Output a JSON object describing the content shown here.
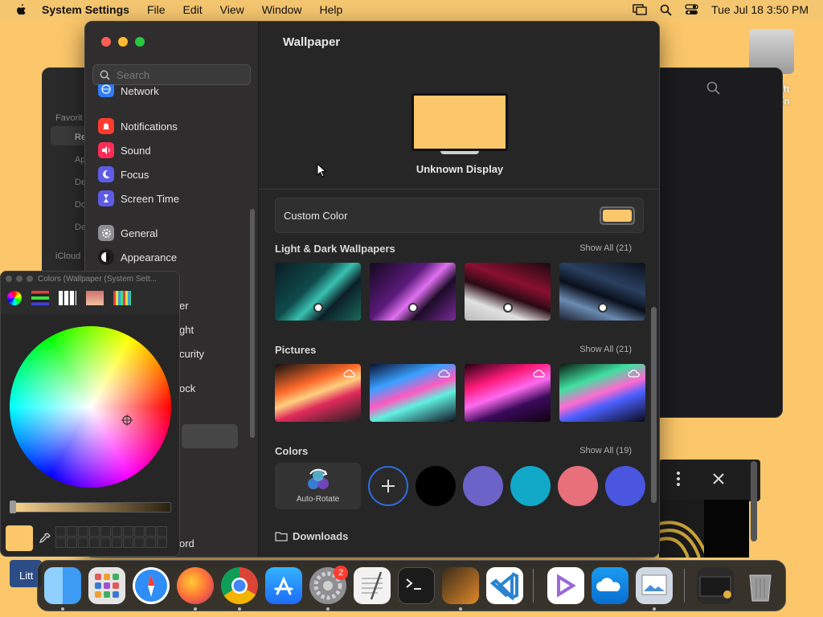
{
  "menubar": {
    "app_name": "System Settings",
    "items": [
      "File",
      "Edit",
      "View",
      "Window",
      "Help"
    ],
    "datetime": "Tue Jul 18  3:50 PM"
  },
  "desktop": {
    "disk_label_line1": "aft",
    "disk_label_line2": "on"
  },
  "background_window": {
    "sidebar_labels": [
      "Favorit",
      "Re",
      "Ap",
      "De",
      "Do",
      "De",
      "iCloud"
    ]
  },
  "settings": {
    "search_placeholder": "Search",
    "sidebar_items": [
      {
        "label": "Network",
        "icon": "globe-icon",
        "color": "#2f7cf6"
      },
      {
        "label": "Notifications",
        "icon": "bell-icon",
        "color": "#ff3b30"
      },
      {
        "label": "Sound",
        "icon": "speaker-icon",
        "color": "#ff2d55"
      },
      {
        "label": "Focus",
        "icon": "moon-icon",
        "color": "#5e5ce6"
      },
      {
        "label": "Screen Time",
        "icon": "hourglass-icon",
        "color": "#5e5ce6"
      },
      {
        "label": "General",
        "icon": "gear-icon",
        "color": "#8e8e93"
      },
      {
        "label": "Appearance",
        "icon": "appearance-icon",
        "color": "#1c1c1e"
      }
    ],
    "sidebar_partial_items": [
      "er",
      "ght",
      "curity",
      "ock",
      "ord"
    ],
    "page_title": "Wallpaper",
    "display_name": "Unknown Display",
    "custom_color_label": "Custom Color",
    "custom_color_value": "#fcc76a",
    "sections": {
      "light_dark": {
        "title": "Light & Dark Wallpapers",
        "show_all": "Show All (21)"
      },
      "pictures": {
        "title": "Pictures",
        "show_all": "Show All (21)"
      },
      "colors": {
        "title": "Colors",
        "show_all": "Show All (19)"
      },
      "downloads": {
        "title": "Downloads"
      }
    },
    "auto_rotate_label": "Auto-Rotate",
    "color_swatches": [
      "#000000",
      "#6b63c7",
      "#12a9c9",
      "#e8707b",
      "#4a55e0"
    ]
  },
  "colors_panel": {
    "title": "Colors (Wallpaper (System Sett...",
    "current_color": "#fcc76a"
  },
  "dock": {
    "settings_badge": "2",
    "apps": [
      {
        "name": "finder-icon",
        "color": "#3d9bf4"
      },
      {
        "name": "launchpad-icon",
        "color": "#e5e5e5"
      },
      {
        "name": "safari-icon",
        "color": "#2f8ef5"
      },
      {
        "name": "firefox-icon",
        "color": "#ff7139"
      },
      {
        "name": "chrome-icon",
        "color": "#ffffff"
      },
      {
        "name": "app-store-icon",
        "color": "#1d8cf8"
      },
      {
        "name": "system-settings-icon",
        "color": "#8e8e93"
      },
      {
        "name": "textedit-icon",
        "color": "#f2f2f2"
      },
      {
        "name": "terminal-icon",
        "color": "#1b1b1b"
      },
      {
        "name": "garageband-icon",
        "color": "#e08a2a"
      },
      {
        "name": "vscode-icon",
        "color": "#2b83cf"
      },
      {
        "name": "visual-studio-icon",
        "color": "#9a6ad6"
      },
      {
        "name": "onedrive-icon",
        "color": "#0a6ed1"
      },
      {
        "name": "preview-icon",
        "color": "#cfd8e3"
      },
      {
        "name": "recent-window-icon",
        "color": "#2a2a2a"
      },
      {
        "name": "trash-icon",
        "color": "#9a9a9a"
      }
    ]
  },
  "partial_window_label": "Litt"
}
